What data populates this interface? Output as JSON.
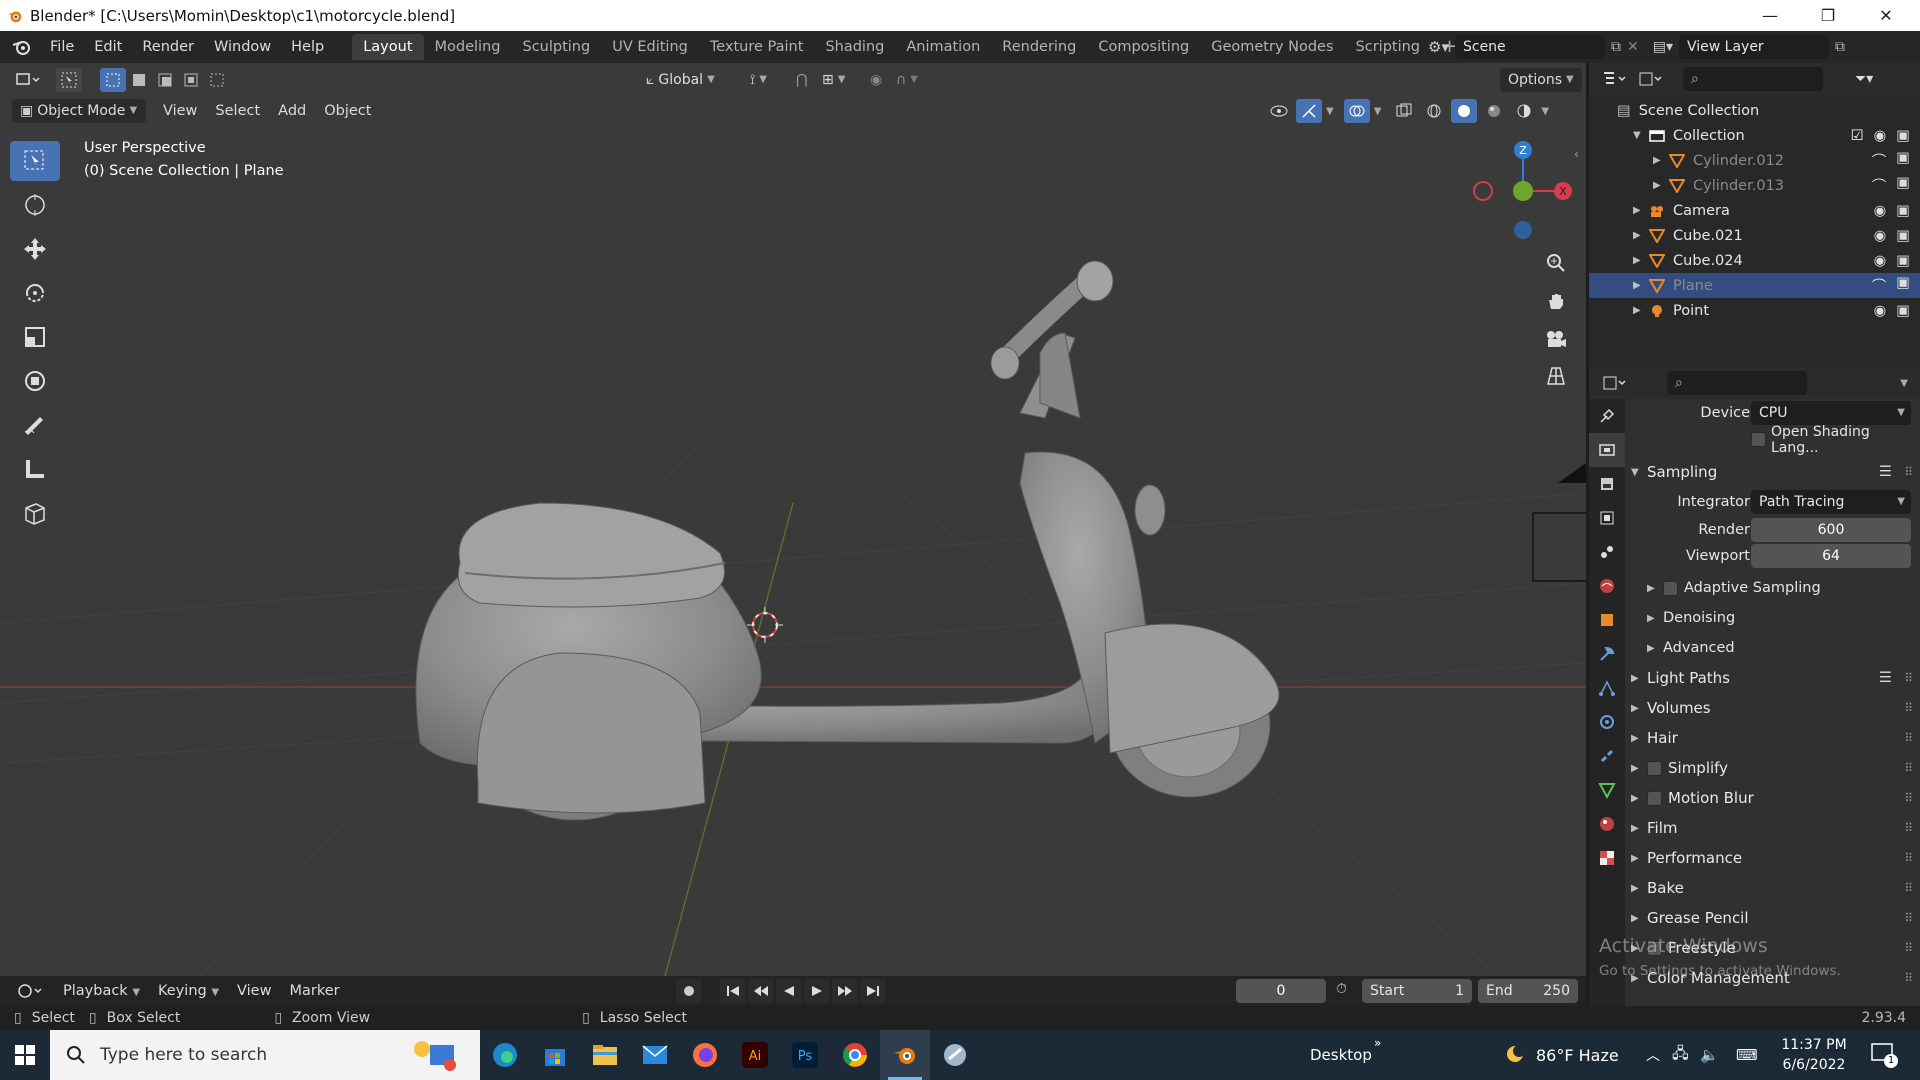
{
  "window": {
    "title": "Blender* [C:\\Users\\Momin\\Desktop\\c1\\motorcycle.blend]",
    "minimize": "—",
    "maximize": "❐",
    "close": "✕"
  },
  "menu": {
    "items": [
      "File",
      "Edit",
      "Render",
      "Window",
      "Help"
    ]
  },
  "workspaces": [
    "Layout",
    "Modeling",
    "Sculpting",
    "UV Editing",
    "Texture Paint",
    "Shading",
    "Animation",
    "Rendering",
    "Compositing",
    "Geometry Nodes",
    "Scripting"
  ],
  "active_workspace": "Layout",
  "scene": {
    "name": "Scene",
    "view_layer": "View Layer"
  },
  "viewport": {
    "mode": "Object Mode",
    "menus": [
      "View",
      "Select",
      "Add",
      "Object"
    ],
    "transform_orientation": "Global",
    "options_label": "Options",
    "overlay_title": "User Perspective",
    "overlay_subtitle": "(0) Scene Collection | Plane",
    "gizmo": {
      "z": "Z",
      "accent_x": "#d63b4f",
      "accent_y": "#6ea52b",
      "accent_z": "#2f7fd2"
    }
  },
  "outliner": {
    "root": "Scene Collection",
    "items": [
      {
        "name": "Collection",
        "indent": 1,
        "kind": "collection",
        "dim": false,
        "selected": false
      },
      {
        "name": "Cylinder.012",
        "indent": 2,
        "kind": "mesh",
        "dim": true,
        "selected": false
      },
      {
        "name": "Cylinder.013",
        "indent": 2,
        "kind": "mesh",
        "dim": true,
        "selected": false
      },
      {
        "name": "Camera",
        "indent": 1,
        "kind": "camera",
        "dim": false,
        "selected": false
      },
      {
        "name": "Cube.021",
        "indent": 1,
        "kind": "mesh",
        "dim": false,
        "selected": false
      },
      {
        "name": "Cube.024",
        "indent": 1,
        "kind": "mesh",
        "dim": false,
        "selected": false
      },
      {
        "name": "Plane",
        "indent": 1,
        "kind": "mesh",
        "dim": true,
        "selected": true
      },
      {
        "name": "Point",
        "indent": 1,
        "kind": "light",
        "dim": false,
        "selected": false
      }
    ]
  },
  "properties": {
    "device_label": "Device",
    "device_value": "CPU",
    "osl_label": "Open Shading Lang...",
    "sampling": {
      "title": "Sampling",
      "integrator_label": "Integrator",
      "integrator_value": "Path Tracing",
      "render_label": "Render",
      "render_value": "600",
      "viewport_label": "Viewport",
      "viewport_value": "64",
      "sub": [
        "Adaptive Sampling",
        "Denoising",
        "Advanced"
      ]
    },
    "panels": [
      "Light Paths",
      "Volumes",
      "Hair",
      "Simplify",
      "Motion Blur",
      "Film",
      "Performance",
      "Bake",
      "Grease Pencil",
      "Freestyle",
      "Color Management"
    ]
  },
  "timeline": {
    "menus": [
      "Playback",
      "Keying",
      "View",
      "Marker"
    ],
    "current_frame": "0",
    "start_label": "Start",
    "start_value": "1",
    "end_label": "End",
    "end_value": "250"
  },
  "statusbar": {
    "select": "Select",
    "box_select": "Box Select",
    "zoom_view": "Zoom View",
    "lasso_select": "Lasso Select",
    "version": "2.93.4"
  },
  "watermark": {
    "line1": "Activate Windows",
    "line2": "Go to Settings to activate Windows."
  },
  "taskbar": {
    "search_placeholder": "Type here to search",
    "desktop_label": "Desktop",
    "weather": "86°F  Haze",
    "time": "11:37 PM",
    "date": "6/6/2022",
    "notif_count": "1",
    "apps": [
      "edge",
      "store",
      "explorer",
      "mail",
      "firefox",
      "illustrator",
      "photoshop",
      "chrome",
      "blender",
      "other"
    ]
  }
}
